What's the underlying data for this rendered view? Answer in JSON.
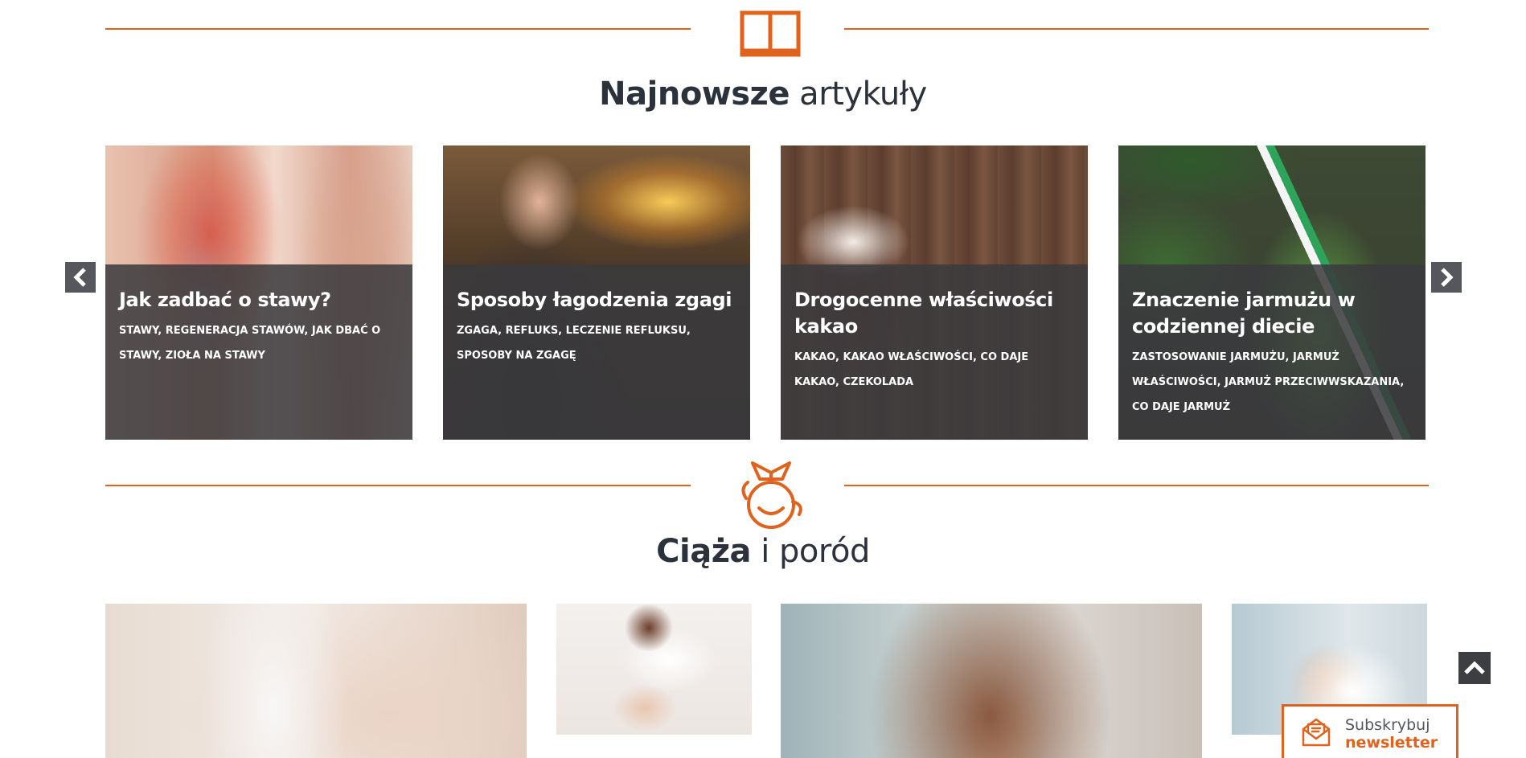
{
  "latest_section": {
    "title_bold": "Najnowsze",
    "title_light": " artykuły",
    "icon": "open-book-icon"
  },
  "carousel": {
    "prev_icon": "chevron-left-icon",
    "next_icon": "chevron-right-icon",
    "cards": [
      {
        "title": "Jak zadbać o stawy?",
        "tags": "stawy, regeneracja stawów, jak dbać o stawy, zioła na stawy"
      },
      {
        "title": "Sposoby łagodzenia zgagi",
        "tags": "zgaga, refluks, leczenie refluksu, sposoby na zgagę"
      },
      {
        "title": "Drogocenne właściwości kakao",
        "tags": "kakao, kakao właściwości, co daje kakao, czekolada"
      },
      {
        "title": "Znaczenie jarmużu w codziennej diecie",
        "tags": "zastosowanie jarmużu, jarmuż właściwości, jarmuż przeciwwskazania, co daje jarmuż"
      }
    ]
  },
  "pregnancy_section": {
    "title_bold": "Ciąża",
    "title_light": " i poród",
    "icon": "stork-baby-icon"
  },
  "scroll_top": {
    "icon": "chevron-up-icon"
  },
  "newsletter": {
    "line1": "Subskrybuj",
    "line2": "newsletter",
    "icon": "envelope-letter-icon"
  },
  "colors": {
    "accent": "#e0621c",
    "text": "#2c323c",
    "overlay": "#3a3a3e"
  }
}
